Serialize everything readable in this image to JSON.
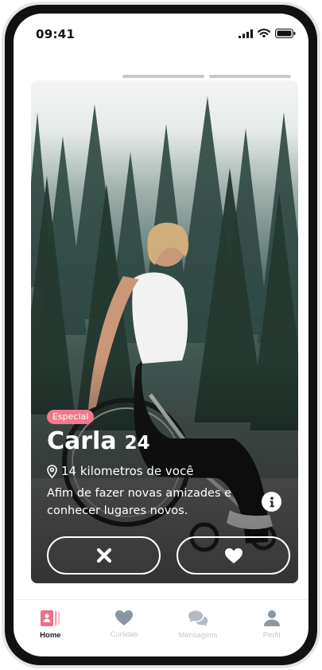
{
  "status_bar": {
    "time": "09:41"
  },
  "profile": {
    "badge": "Especial",
    "name": "Carla",
    "age": "24",
    "distance": "14 kilometros de você",
    "bio": "Afim de fazer novas amizades e conhecer lugares novos."
  },
  "story_progress": {
    "segments": 2
  },
  "actions": {
    "dislike_icon": "close-icon",
    "like_icon": "heart-icon"
  },
  "tabs": [
    {
      "label": "Home",
      "icon": "home-cards-icon",
      "active": true
    },
    {
      "label": "Curtidas",
      "icon": "heart-icon",
      "active": false
    },
    {
      "label": "Mensagens",
      "icon": "chat-bubbles-icon",
      "active": false
    },
    {
      "label": "Perfil",
      "icon": "person-icon",
      "active": false
    }
  ],
  "colors": {
    "accent": "#f07a8a",
    "tab_inactive": "#c3c8cf",
    "tab_active": "#1b1b1b"
  }
}
